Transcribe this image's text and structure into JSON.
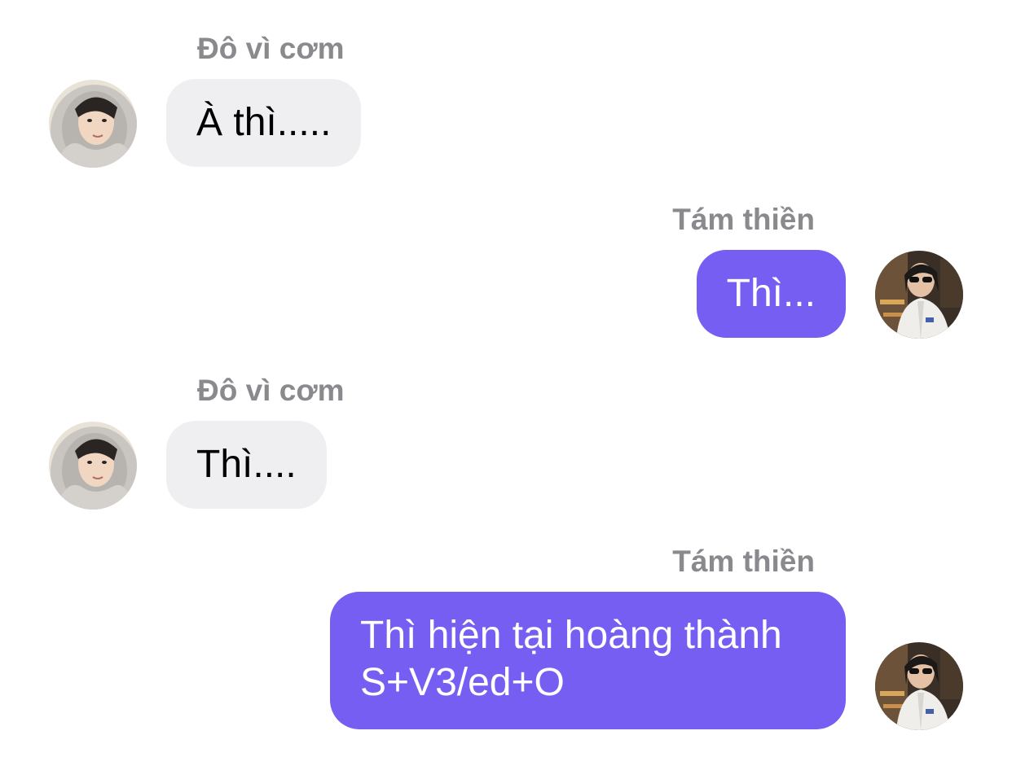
{
  "messages": [
    {
      "side": "incoming",
      "sender": "Đô vì cơm",
      "lines": [
        "À thì....."
      ]
    },
    {
      "side": "outgoing",
      "sender": "Tám thiền",
      "lines": [
        "Thì..."
      ]
    },
    {
      "side": "incoming",
      "sender": "Đô vì cơm",
      "lines": [
        "Thì...."
      ]
    },
    {
      "side": "outgoing",
      "sender": "Tám thiền",
      "lines": [
        "Thì hiện tại hoàng thành",
        "S+V3/ed+O"
      ]
    }
  ],
  "colors": {
    "incoming_bubble": "#efeff2",
    "outgoing_bubble": "#765ef2",
    "sender_name": "#8a8a8e"
  }
}
